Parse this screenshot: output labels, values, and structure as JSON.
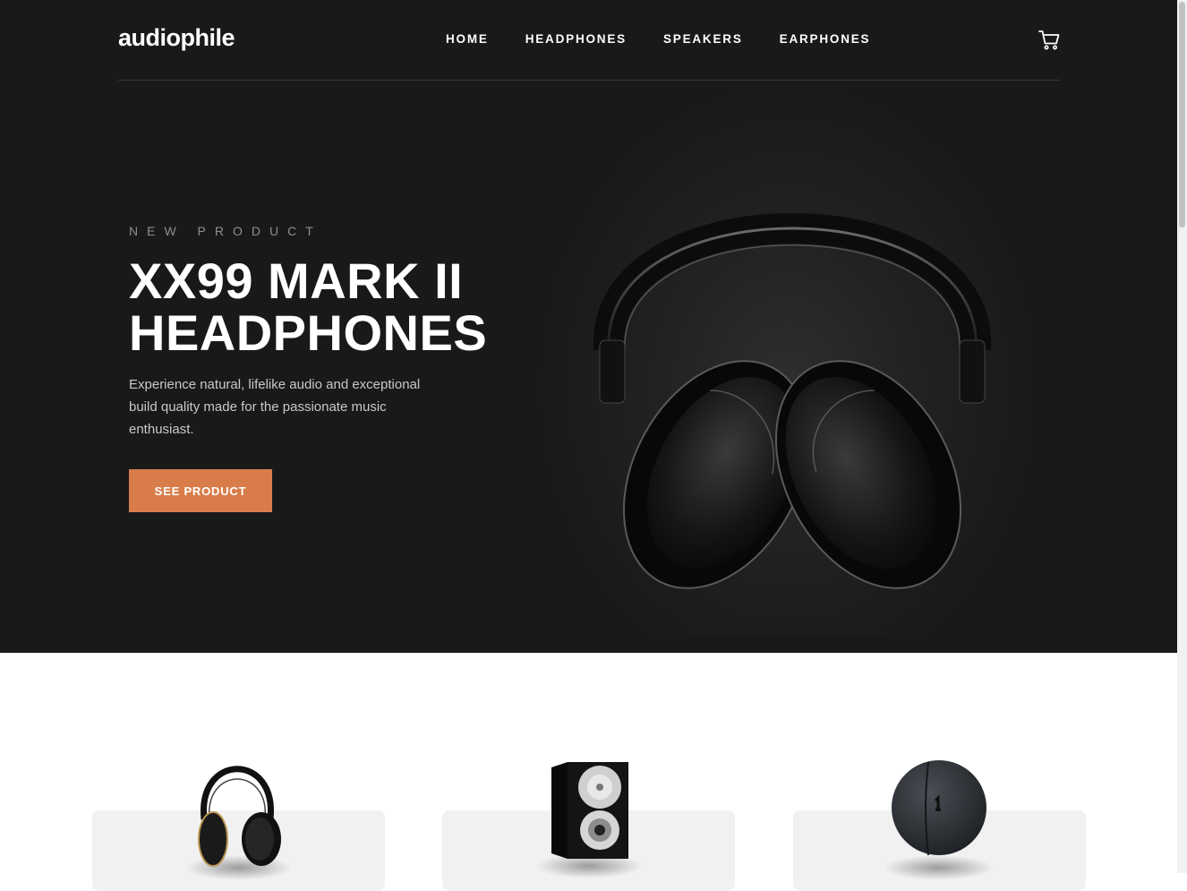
{
  "brand": {
    "logo": "audiophile"
  },
  "nav": {
    "links": [
      {
        "label": "HOME"
      },
      {
        "label": "HEADPHONES"
      },
      {
        "label": "SPEAKERS"
      },
      {
        "label": "EARPHONES"
      }
    ],
    "cart_icon": "cart-icon"
  },
  "hero": {
    "eyebrow": "NEW PRODUCT",
    "title_line1": "XX99 MARK II",
    "title_line2": "HEADPHONES",
    "description": "Experience natural, lifelike audio and exceptional build quality made for the passionate music enthusiast.",
    "cta_label": "SEE PRODUCT",
    "image": "headphones-image"
  },
  "categories": [
    {
      "image": "headphones-thumbnail"
    },
    {
      "image": "speaker-thumbnail"
    },
    {
      "image": "earphones-case-thumbnail"
    }
  ],
  "colors": {
    "hero_bg": "#191919",
    "accent": "#d87d4a",
    "card_bg": "#f1f1f1"
  }
}
